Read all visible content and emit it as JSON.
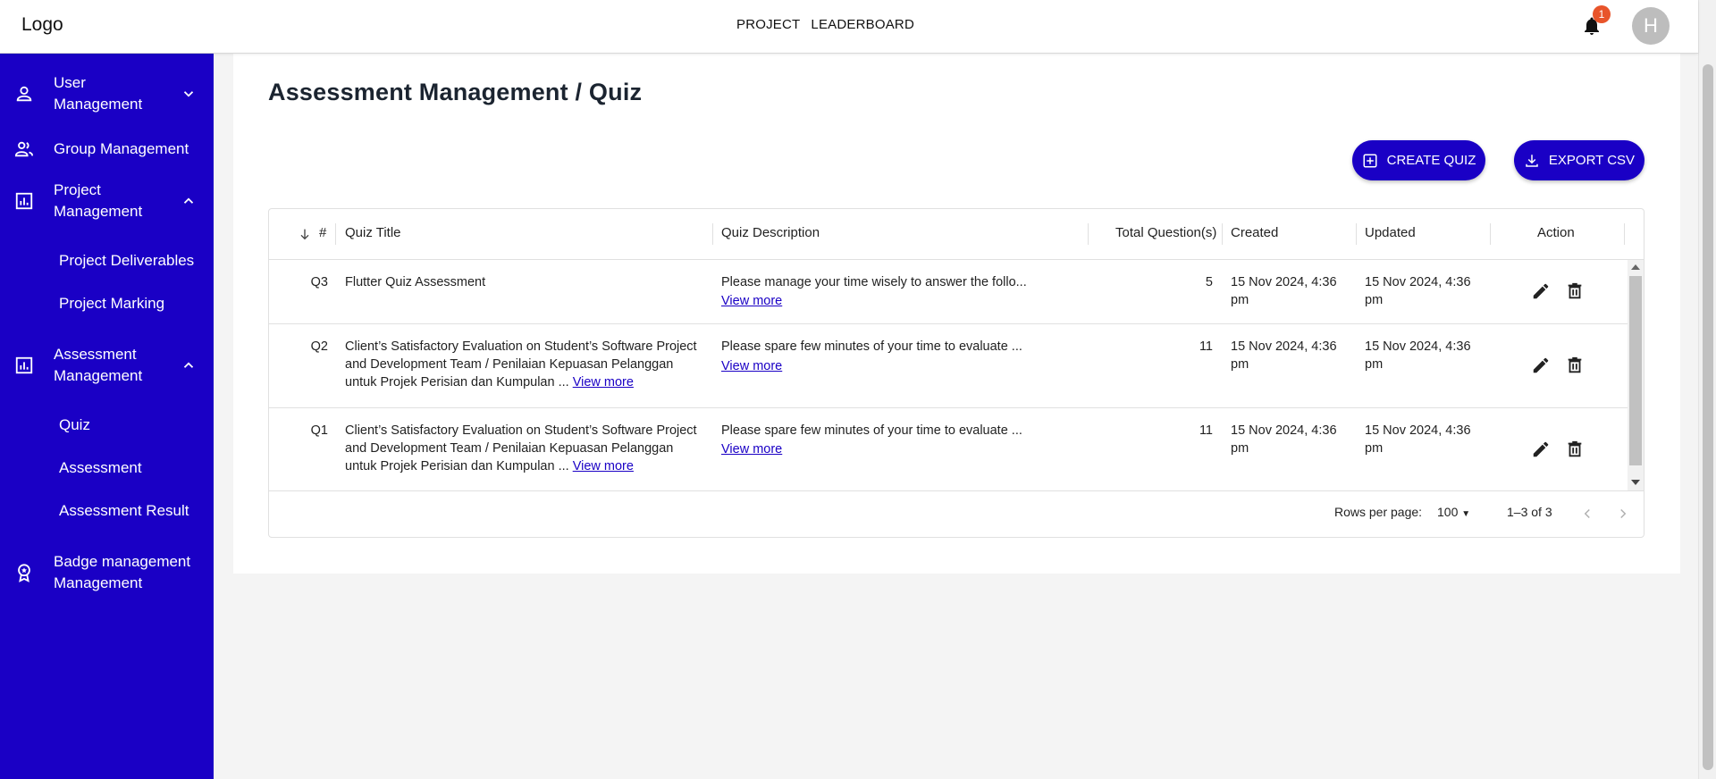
{
  "header": {
    "logo": "Logo",
    "nav": [
      "PROJECT",
      "LEADERBOARD"
    ],
    "notification_count": "1",
    "avatar_initial": "H"
  },
  "sidebar": {
    "items": [
      {
        "label_line1": "User",
        "label_line2": "Management",
        "icon": "person-icon",
        "chevron": "down"
      },
      {
        "label_line1": "Group Management",
        "icon": "group-icon"
      },
      {
        "label_line1": "Project",
        "label_line2": "Management",
        "icon": "bar-chart-icon",
        "chevron": "up",
        "children": [
          "Project Deliverables",
          "Project Marking"
        ]
      },
      {
        "label_line1": "Assessment",
        "label_line2": "Management",
        "icon": "bar-chart-icon",
        "chevron": "up",
        "children": [
          "Quiz",
          "Assessment",
          "Assessment Result"
        ]
      },
      {
        "label_line1": "Badge management",
        "label_line2": "Management",
        "icon": "badge-icon"
      }
    ]
  },
  "page": {
    "title": "Assessment Management / Quiz",
    "create_label": "CREATE QUIZ",
    "export_label": "EXPORT CSV"
  },
  "table": {
    "columns": {
      "id": "#",
      "title": "Quiz Title",
      "description": "Quiz Description",
      "total": "Total Question(s)",
      "created": "Created",
      "updated": "Updated",
      "action": "Action"
    },
    "view_more": "View more",
    "rows": [
      {
        "id": "Q3",
        "title_lines": [
          "Flutter Quiz Assessment"
        ],
        "title_view_more": false,
        "description": "Please manage your time wisely to answer the follo...",
        "total": "5",
        "created_line1": "15 Nov 2024, 4:36",
        "created_line2": "pm",
        "updated_line1": "15 Nov 2024, 4:36",
        "updated_line2": "pm"
      },
      {
        "id": "Q2",
        "title_lines": [
          "Client’s Satisfactory Evaluation on Student’s Software Project",
          "and Development Team / Penilaian Kepuasan Pelanggan",
          "untuk Projek Perisian dan Kumpulan ..."
        ],
        "title_view_more": true,
        "description": "Please spare few minutes of your time to evaluate ...",
        "total": "11",
        "created_line1": "15 Nov 2024, 4:36",
        "created_line2": "pm",
        "updated_line1": "15 Nov 2024, 4:36",
        "updated_line2": "pm"
      },
      {
        "id": "Q1",
        "title_lines": [
          "Client’s Satisfactory Evaluation on Student’s Software Project",
          "and Development Team / Penilaian Kepuasan Pelanggan",
          "untuk Projek Perisian dan Kumpulan ..."
        ],
        "title_view_more": true,
        "description": "Please spare few minutes of your time to evaluate ...",
        "total": "11",
        "created_line1": "15 Nov 2024, 4:36",
        "created_line2": "pm",
        "updated_line1": "15 Nov 2024, 4:36",
        "updated_line2": "pm"
      }
    ],
    "pagination": {
      "rows_per_page_label": "Rows per page:",
      "rows_per_page": "100",
      "range": "1–3 of 3"
    }
  },
  "colors": {
    "brand": "#1a00c5",
    "badge": "#e8542a"
  }
}
